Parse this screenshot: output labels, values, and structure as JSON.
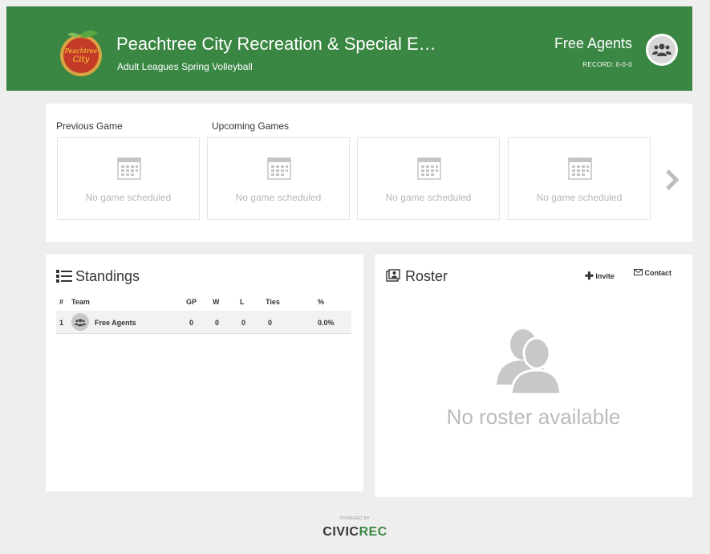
{
  "header": {
    "org_title": "Peachtree City Recreation & Special E…",
    "org_subtitle": "Adult Leagues Spring Volleyball",
    "team_name": "Free Agents",
    "team_record": "RECORD: 0-0-0",
    "logo_text": "Peachtree City",
    "bg_color": "#3a8643"
  },
  "games": {
    "previous_label": "Previous Game",
    "upcoming_label": "Upcoming Games",
    "slots": [
      {
        "text": "No game scheduled"
      },
      {
        "text": "No game scheduled"
      },
      {
        "text": "No game scheduled"
      },
      {
        "text": "No game scheduled"
      }
    ],
    "next_icon": "chevron-right-icon"
  },
  "standings": {
    "title": "Standings",
    "columns": [
      "#",
      "Team",
      "GP",
      "W",
      "L",
      "Ties",
      "%"
    ],
    "rows": [
      {
        "rank": "1",
        "team": "Free Agents",
        "gp": "0",
        "w": "0",
        "l": "0",
        "ties": "0",
        "pct": "0.0%"
      }
    ]
  },
  "roster": {
    "title": "Roster",
    "invite_label": "Invite",
    "contact_label": "Contact",
    "empty_text": "No roster available"
  },
  "footer": {
    "powered_by": "POWERED BY",
    "brand_a": "CIVIC",
    "brand_b": "REC"
  }
}
